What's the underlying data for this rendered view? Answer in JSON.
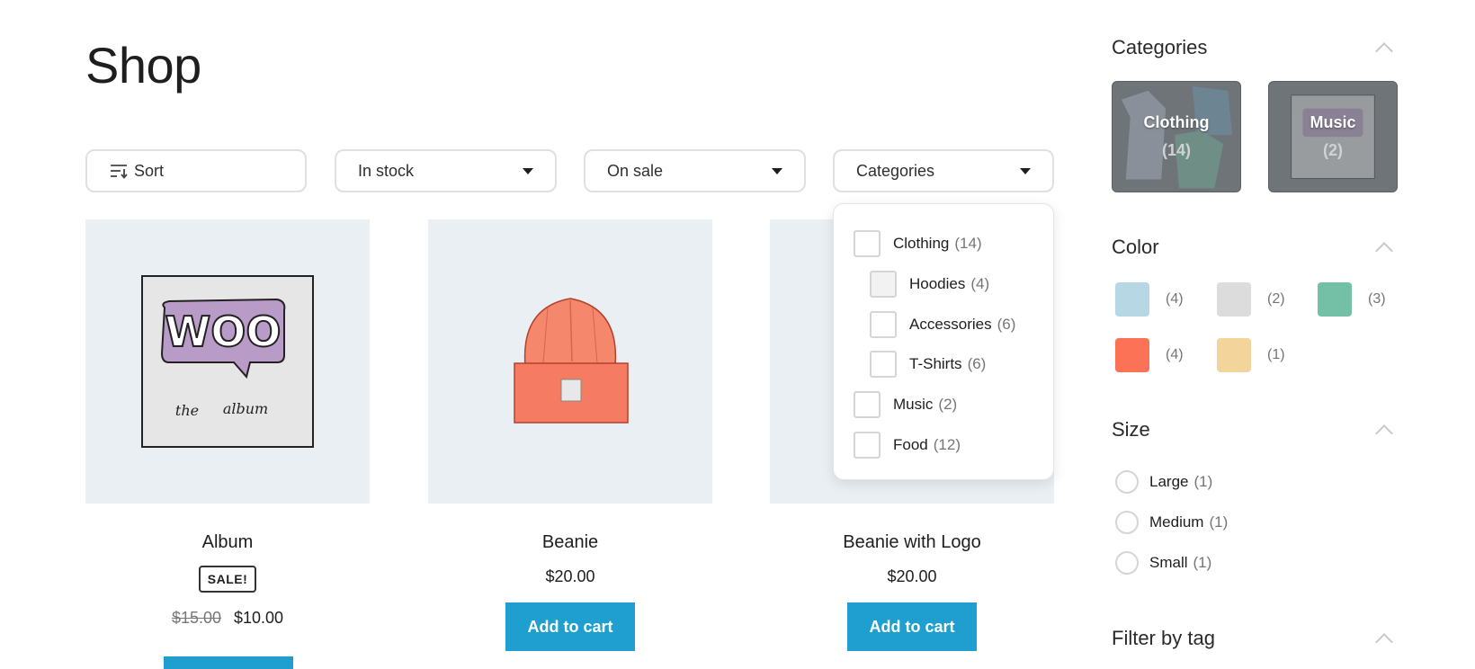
{
  "page": {
    "title": "Shop"
  },
  "filters": {
    "sort_label": "Sort",
    "stock_label": "In stock",
    "sale_label": "On sale",
    "categories_label": "Categories"
  },
  "products": [
    {
      "name": "Album",
      "badge": "SALE!",
      "old_price": "$15.00",
      "price": "$10.00"
    },
    {
      "name": "Beanie",
      "price": "$20.00",
      "button": "Add to cart"
    },
    {
      "name": "Beanie with Logo",
      "price": "$20.00",
      "button": "Add to cart"
    }
  ],
  "album_art": {
    "logo_text": "WOO",
    "caption_left": "the",
    "caption_right": "album"
  },
  "dropdown": {
    "items": [
      {
        "label": "Clothing",
        "count": "(14)"
      },
      {
        "label": "Hoodies",
        "count": "(4)"
      },
      {
        "label": "Accessories",
        "count": "(6)"
      },
      {
        "label": "T-Shirts",
        "count": "(6)"
      },
      {
        "label": "Music",
        "count": "(2)"
      },
      {
        "label": "Food",
        "count": "(12)"
      }
    ]
  },
  "sidebar": {
    "categories": {
      "title": "Categories",
      "cards": [
        {
          "name": "Clothing",
          "count": "(14)"
        },
        {
          "name": "Music",
          "count": "(2)"
        }
      ]
    },
    "color": {
      "title": "Color",
      "swatches": [
        {
          "color": "#b8d7e4",
          "count": "(4)"
        },
        {
          "color": "#dcdcdc",
          "count": "(2)"
        },
        {
          "color": "#73c0a6",
          "count": "(3)"
        },
        {
          "color": "#fb7256",
          "count": "(4)"
        },
        {
          "color": "#f3d49a",
          "count": "(1)"
        }
      ]
    },
    "size": {
      "title": "Size",
      "options": [
        {
          "label": "Large",
          "count": "(1)"
        },
        {
          "label": "Medium",
          "count": "(1)"
        },
        {
          "label": "Small",
          "count": "(1)"
        }
      ]
    },
    "tags": {
      "title": "Filter by tag"
    }
  },
  "colors": {
    "accent": "#1e9fd0",
    "tile_bg": "#e9eff3"
  }
}
